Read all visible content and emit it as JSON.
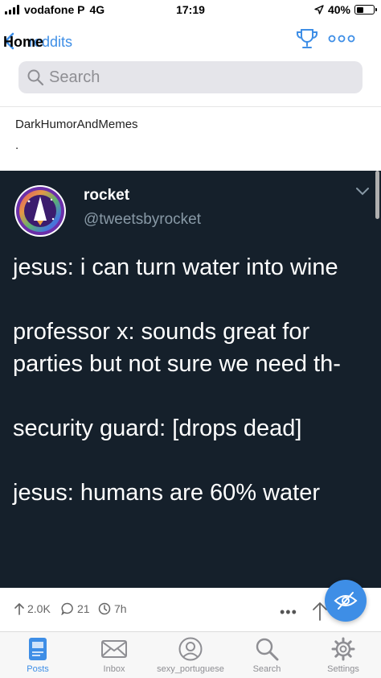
{
  "status_bar": {
    "carrier": "vodafone P",
    "network": "4G",
    "time": "17:19",
    "battery_text": "40%",
    "battery_level": 0.4
  },
  "nav": {
    "home_label": "Home",
    "back_label": "Subreddits",
    "back_visible_fragment": "reddits"
  },
  "search": {
    "placeholder": "Search"
  },
  "post": {
    "subreddit": "DarkHumorAndMemes",
    "title": "."
  },
  "tweet": {
    "name": "rocket",
    "handle": "@tweetsbyrocket",
    "lines": [
      "jesus: i can turn water into wine",
      "professor x: sounds great for parties but not sure we need th-",
      "security guard: [drops dead]",
      "jesus: humans are 60% water"
    ]
  },
  "actions": {
    "upvotes": "2.0K",
    "comments": "21",
    "age": "7h"
  },
  "tabbar": {
    "tabs": [
      {
        "label": "Posts",
        "icon": "posts-icon",
        "active": true
      },
      {
        "label": "Inbox",
        "icon": "inbox-icon",
        "active": false
      },
      {
        "label": "sexy_portuguese",
        "icon": "account-icon",
        "active": false
      },
      {
        "label": "Search",
        "icon": "search-icon",
        "active": false
      },
      {
        "label": "Settings",
        "icon": "settings-icon",
        "active": false
      }
    ]
  },
  "colors": {
    "accent": "#3e8ee6",
    "tweet_bg": "#15202b",
    "tweet_handle": "#8899a6",
    "inactive": "#8e8e93"
  }
}
